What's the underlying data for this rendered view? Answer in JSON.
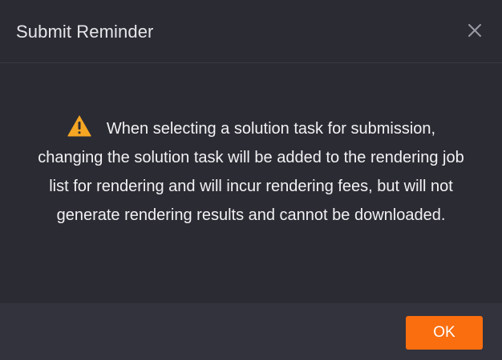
{
  "dialog": {
    "title": "Submit Reminder",
    "close_icon": "close-icon",
    "warning_icon": "warning-triangle-icon",
    "message": "When selecting a solution task for submission, changing the solution task will be added to the rendering job list for rendering and will incur rendering fees, but will not generate rendering results and cannot be downloaded.",
    "ok_label": "OK"
  },
  "colors": {
    "background": "#2b2b34",
    "footer": "#33333d",
    "accent": "#fa6e0f",
    "warning": "#f5a623",
    "text": "#f2f2f4"
  }
}
